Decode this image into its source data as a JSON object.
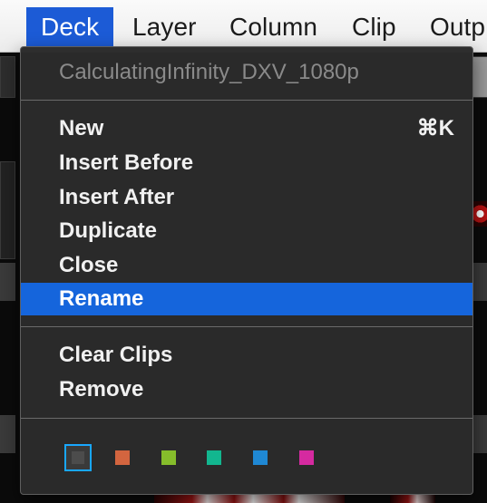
{
  "menubar": {
    "items": [
      {
        "label": "Deck"
      },
      {
        "label": "Layer"
      },
      {
        "label": "Column"
      },
      {
        "label": "Clip"
      },
      {
        "label": "Outp"
      }
    ]
  },
  "menu": {
    "title": "CalculatingInfinity_DXV_1080p",
    "items": [
      {
        "label": "New",
        "shortcut": "⌘K"
      },
      {
        "label": "Insert Before"
      },
      {
        "label": "Insert After"
      },
      {
        "label": "Duplicate"
      },
      {
        "label": "Close"
      },
      {
        "label": "Rename",
        "selected": true
      },
      {
        "label": "Clear Clips"
      },
      {
        "label": "Remove"
      }
    ],
    "swatches": [
      {
        "name": "gray",
        "color": "#4c4c4c",
        "selected": true
      },
      {
        "name": "orange",
        "color": "#d3653f"
      },
      {
        "name": "green",
        "color": "#86bd2b"
      },
      {
        "name": "teal",
        "color": "#12b68f"
      },
      {
        "name": "blue",
        "color": "#1f88d4"
      },
      {
        "name": "magenta",
        "color": "#d52aa0"
      }
    ]
  }
}
